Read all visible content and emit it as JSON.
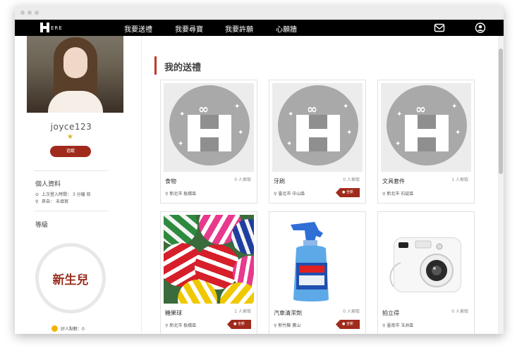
{
  "nav": {
    "logo_text": "ERE",
    "links": [
      "我要送禮",
      "我要尋寶",
      "我要許願",
      "心願牆"
    ],
    "mail_icon": "mail-icon",
    "account_icon": "account-icon"
  },
  "profile": {
    "username": "joyce123",
    "follow_label": "追蹤",
    "info_title": "個人資料",
    "last_login_label": "上次登入時間：",
    "last_login_value": "3 分鐘 前",
    "from_label": "來自：",
    "from_value": "未填寫",
    "level_title": "等級",
    "level_name": "新生兒",
    "good_label": "好人點數：",
    "good_value": "0"
  },
  "main": {
    "title": "我的送禮",
    "gifts": [
      {
        "name": "食物",
        "requests": "0 人索取",
        "location": "新北市 板橋區",
        "tag": ""
      },
      {
        "name": "牙刷",
        "requests": "0 人索取",
        "location": "臺北市 中山區",
        "tag": "全新"
      },
      {
        "name": "文具套件",
        "requests": "1 人索取",
        "location": "新北市 石碇區",
        "tag": ""
      },
      {
        "name": "糖果球",
        "requests": "1 人索取",
        "location": "新北市 板橋區",
        "tag": "全新"
      },
      {
        "name": "汽車清潔劑",
        "requests": "0 人索取",
        "location": "新竹縣 寶山",
        "tag": "全新"
      },
      {
        "name": "拍立得",
        "requests": "0 人索取",
        "location": "臺南市 玉井區",
        "tag": ""
      }
    ]
  },
  "colors": {
    "accent": "#a02a1c",
    "navbar": "#000000",
    "gold": "#e0b320"
  }
}
